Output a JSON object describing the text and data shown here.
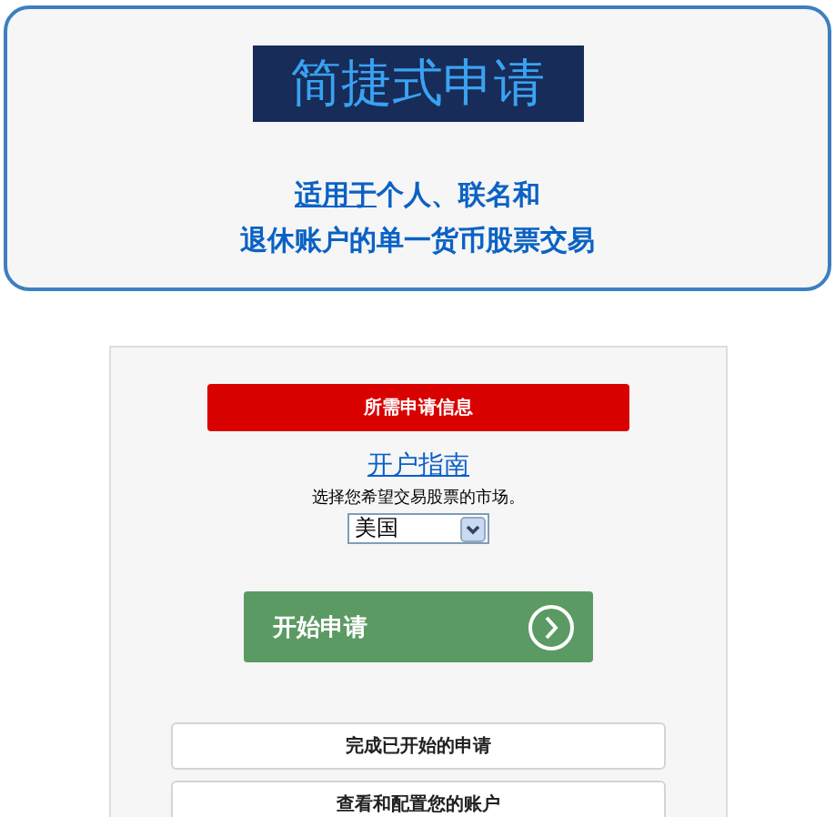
{
  "header": {
    "title": "简捷式申请",
    "subtitle_link": "适用于",
    "subtitle_rest": "个人、联名和",
    "subtitle_line2": "退休账户的单一货币股票交易"
  },
  "panel": {
    "notice": "所需申请信息",
    "guide_link": "开户指南",
    "market_label": "选择您希望交易股票的市场。",
    "market_select": {
      "value": "美国"
    },
    "start_button": "开始申请",
    "buttons": [
      "完成已开始的申请",
      "查看和配置您的账户"
    ]
  }
}
